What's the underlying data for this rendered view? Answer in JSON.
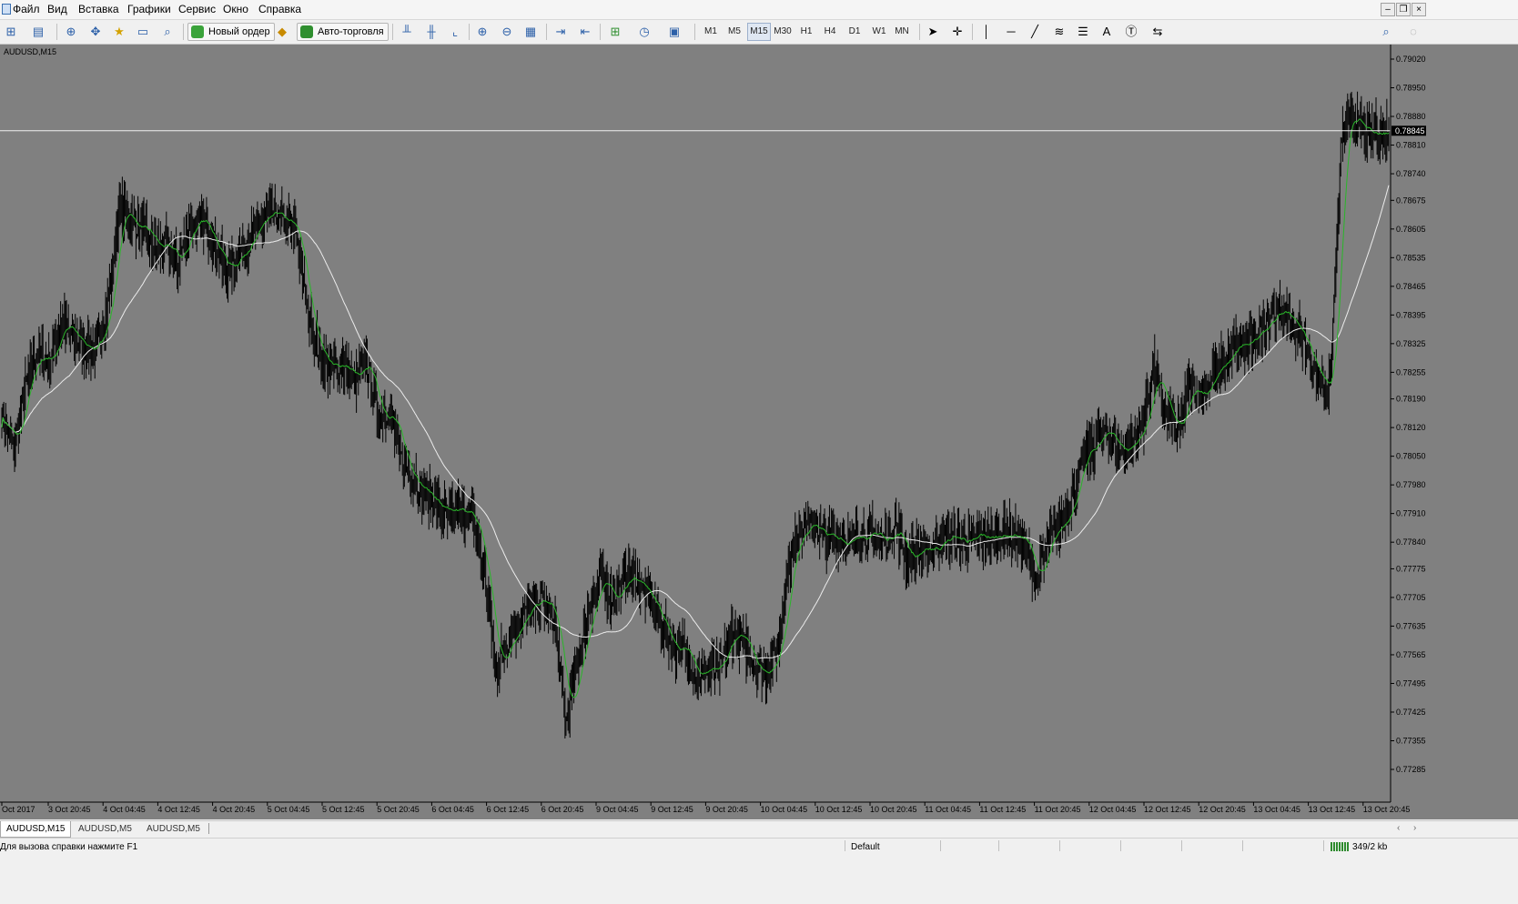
{
  "menu": {
    "items": [
      "Файл",
      "Вид",
      "Вставка",
      "Графики",
      "Сервис",
      "Окно",
      "Справка"
    ],
    "window_controls": [
      "–",
      "❐",
      "×"
    ]
  },
  "toolbar": {
    "new_order_label": "Новый ордер",
    "autotrading_label": "Авто-торговля",
    "timeframes": [
      "M1",
      "M5",
      "M15",
      "M30",
      "H1",
      "H4",
      "D1",
      "W1",
      "MN"
    ],
    "active_timeframe": "M15"
  },
  "chart": {
    "label": "AUDUSD,M15",
    "current_price": "0.78845",
    "colors": {
      "background": "#808080",
      "bars": "#000000",
      "ma_fast": "#29b629",
      "ma_slow": "#ececec",
      "price_line": "#f0f0f0"
    }
  },
  "chart_data": {
    "type": "line",
    "symbol": "AUDUSD",
    "timeframe": "M15",
    "y_ticks": [
      "0.79020",
      "0.78950",
      "0.78880",
      "0.78810",
      "0.78740",
      "0.78675",
      "0.78605",
      "0.78535",
      "0.78465",
      "0.78395",
      "0.78325",
      "0.78255",
      "0.78190",
      "0.78120",
      "0.78050",
      "0.77980",
      "0.77910",
      "0.77840",
      "0.77775",
      "0.77705",
      "0.77635",
      "0.77565",
      "0.77495",
      "0.77425",
      "0.77355",
      "0.77285"
    ],
    "x_ticks": [
      "Oct 2017",
      "3 Oct 20:45",
      "4 Oct 04:45",
      "4 Oct 12:45",
      "4 Oct 20:45",
      "5 Oct 04:45",
      "5 Oct 12:45",
      "5 Oct 20:45",
      "6 Oct 04:45",
      "6 Oct 12:45",
      "6 Oct 20:45",
      "9 Oct 04:45",
      "9 Oct 12:45",
      "9 Oct 20:45",
      "10 Oct 04:45",
      "10 Oct 12:45",
      "10 Oct 20:45",
      "11 Oct 04:45",
      "11 Oct 12:45",
      "11 Oct 20:45",
      "12 Oct 04:45",
      "12 Oct 12:45",
      "12 Oct 20:45",
      "13 Oct 04:45",
      "13 Oct 12:45",
      "13 Oct 20:45"
    ],
    "ylim": [
      0.77285,
      0.7902
    ],
    "current_price": 0.78845,
    "series": [
      {
        "type": "bars",
        "close": [
          0.7815,
          0.7807,
          0.7822,
          0.783,
          0.7828,
          0.7838,
          0.7834,
          0.7832,
          0.7831,
          0.7842,
          0.7866,
          0.7862,
          0.786,
          0.7856,
          0.7856,
          0.7852,
          0.7862,
          0.7862,
          0.7858,
          0.785,
          0.7854,
          0.7858,
          0.7862,
          0.7864,
          0.7862,
          0.786,
          0.784,
          0.783,
          0.7826,
          0.7828,
          0.7823,
          0.7828,
          0.7815,
          0.7816,
          0.7804,
          0.78,
          0.7796,
          0.7793,
          0.779,
          0.7792,
          0.779,
          0.7778,
          0.7753,
          0.776,
          0.7765,
          0.7768,
          0.777,
          0.7765,
          0.774,
          0.7755,
          0.7768,
          0.7775,
          0.777,
          0.7775,
          0.7775,
          0.777,
          0.7765,
          0.7758,
          0.7758,
          0.7752,
          0.7753,
          0.7752,
          0.7762,
          0.776,
          0.7754,
          0.7752,
          0.7758,
          0.778,
          0.7788,
          0.7788,
          0.7785,
          0.7785,
          0.7784,
          0.7786,
          0.7786,
          0.7784,
          0.7788,
          0.778,
          0.7782,
          0.7782,
          0.7785,
          0.7785,
          0.7784,
          0.7785,
          0.7785,
          0.7786,
          0.7786,
          0.7784,
          0.7774,
          0.7784,
          0.7788,
          0.7795,
          0.7805,
          0.7808,
          0.7812,
          0.7806,
          0.7808,
          0.7812,
          0.7826,
          0.7816,
          0.781,
          0.7822,
          0.782,
          0.7825,
          0.7828,
          0.7832,
          0.7832,
          0.7836,
          0.784,
          0.784,
          0.7837,
          0.7831,
          0.7824,
          0.7822,
          0.7884,
          0.7888,
          0.7883,
          0.7884,
          0.7885
        ]
      },
      {
        "name": "",
        "type": "ma_fast"
      },
      {
        "name": "",
        "type": "ma_slow"
      }
    ]
  },
  "tabs": [
    "AUDUSD,M15",
    "AUDUSD,M5",
    "AUDUSD,M5"
  ],
  "status": {
    "help_text": "Для вызова справки нажмите F1",
    "profile": "Default",
    "traffic": "349/2 kb"
  }
}
